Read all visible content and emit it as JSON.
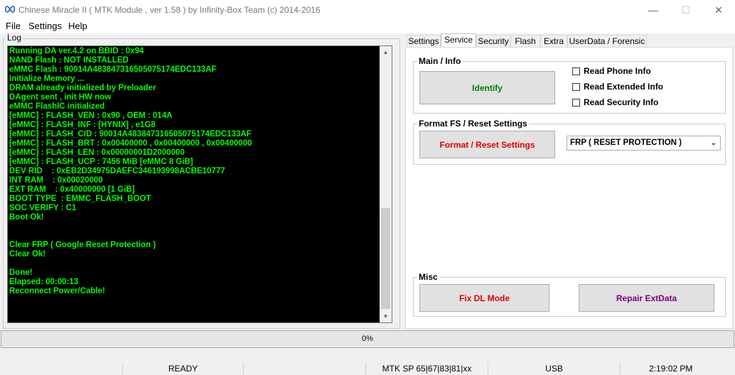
{
  "window": {
    "title": "Chinese Miracle II ( MTK Module , ver 1.58 ) by Infinity-Box Team (c) 2014-2016",
    "minimize_glyph": "—",
    "maximize_glyph": "☐",
    "close_glyph": "✕"
  },
  "menu": {
    "items": [
      "File",
      "Settings",
      "Help"
    ]
  },
  "log": {
    "label": "Log",
    "lines": [
      "Running DA ver.4.2 on BBID : 0x94",
      "NAND Flash : NOT INSTALLED",
      "eMMC Flash : 90014A483847316505075174EDC133AF",
      "Initialize Memory ...",
      "DRAM already initialized by Preloader",
      "DAgent sent , init HW now",
      "eMMC FlashIC initialized",
      "[eMMC] : FLASH_VEN : 0x90 , OEM : 014A",
      "[eMMC] : FLASH_INF : [HYNIX] , e1G8",
      "[eMMC] : FLASH_CID : 90014A483847316505075174EDC133AF",
      "[eMMC] : FLASH_BRT : 0x00400000 , 0x00400000 , 0x00400000",
      "[eMMC] : FLASH_LEN : 0x00000001D2000000",
      "[eMMC] : FLASH_UCP : 7456 MiB [eMMC 8 GiB]",
      "DEV RID    : 0xEB2D34975DAEFC346193998ACBE10777",
      "INT RAM    : 0x00020000",
      "EXT RAM    : 0x40000000 [1 GiB]",
      "BOOT TYPE  : EMMC_FLASH_BOOT",
      "SOC VERIFY : C1",
      "Boot Ok!",
      "",
      "",
      "Clear FRP ( Google Reset Protection )",
      "Clear Ok!",
      "",
      "Done!",
      "Elapsed: 00:00:13",
      "Reconnect Power/Cable!"
    ],
    "scroll_up": "▲",
    "scroll_down": "▼"
  },
  "tabs": [
    "Settings",
    "Service",
    "Security",
    "Flash",
    "Extra",
    "UserData / Forensic"
  ],
  "active_tab": "Service",
  "service": {
    "main_info": {
      "label": "Main / Info",
      "identify": "Identify",
      "identify_color": "#008000",
      "checks": [
        "Read Phone Info",
        "Read Extended Info",
        "Read Security Info"
      ]
    },
    "format": {
      "label": "Format FS / Reset Settings",
      "button": "Format / Reset Settings",
      "button_color": "#e00000",
      "selected": "FRP ( RESET PROTECTION )"
    },
    "misc": {
      "label": "Misc",
      "fix_dl": "Fix DL Mode",
      "fix_dl_color": "#e00000",
      "repair": "Repair ExtData",
      "repair_color": "#800080"
    }
  },
  "progress": {
    "text": "0%",
    "value": 0
  },
  "status": {
    "state": "READY",
    "platform": "MTK SP 65|67|83|81|xx",
    "port": "USB",
    "time": "2:19:02 PM"
  }
}
